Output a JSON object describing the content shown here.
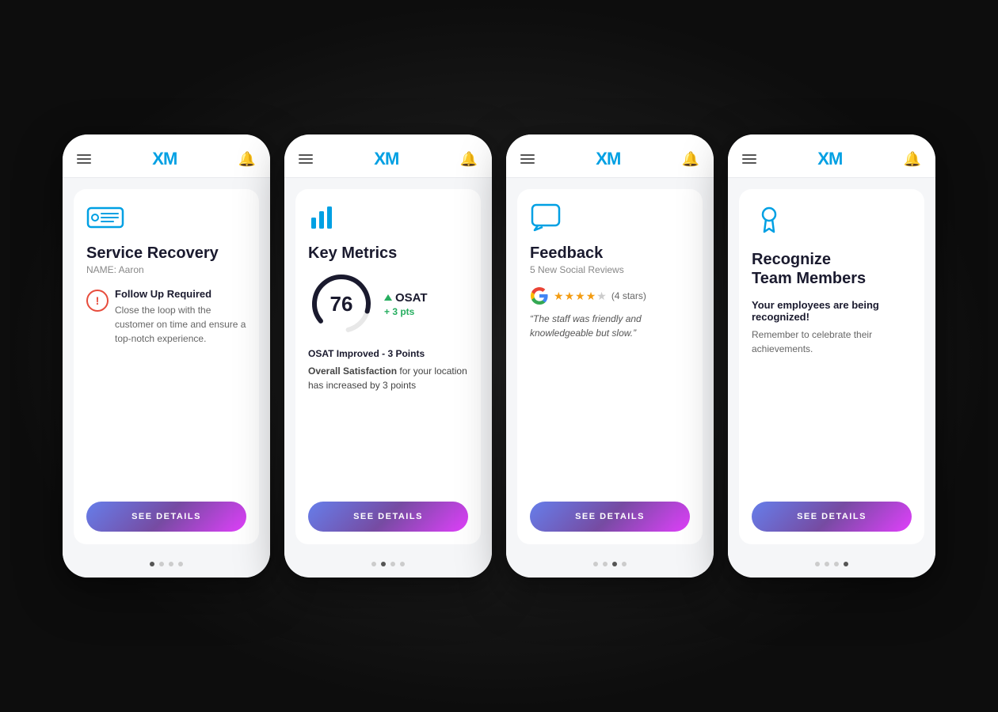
{
  "cards": [
    {
      "id": "service-recovery",
      "logo": "XM",
      "icon_type": "ticket",
      "title": "Service Recovery",
      "subtitle": "NAME: Aaron",
      "alert_title": "Follow Up Required",
      "alert_body": "Close the loop with the customer on time and ensure a top-notch experience.",
      "button_label": "SEE DETAILS",
      "dots": [
        true,
        false,
        false,
        false
      ]
    },
    {
      "id": "key-metrics",
      "logo": "XM",
      "icon_type": "metrics",
      "title": "Key Metrics",
      "subtitle": "",
      "osat_value": "76",
      "osat_label": "OSAT",
      "osat_change": "+ 3 pts",
      "metrics_title": "OSAT Improved - 3 Points",
      "metrics_detail_bold": "Overall Satisfaction",
      "metrics_detail": "for your location has increased by 3 points",
      "button_label": "SEE DETAILS",
      "dots": [
        false,
        true,
        false,
        false
      ]
    },
    {
      "id": "feedback",
      "logo": "XM",
      "icon_type": "feedback",
      "title": "Feedback",
      "subtitle": "5 New Social Reviews",
      "stars_label": "(4 stars)",
      "stars_count": 4,
      "review_text": "“The staff was friendly and knowledgeable but slow.”",
      "button_label": "SEE DETAILS",
      "dots": [
        false,
        false,
        true,
        false
      ]
    },
    {
      "id": "recognize",
      "logo": "XM",
      "icon_type": "recognize",
      "title": "Recognize\nTeam Members",
      "subtitle": "",
      "recognize_highlight": "Your employees are being recognized!",
      "recognize_body": "Remember to celebrate their achievements.",
      "button_label": "SEE DETAILS",
      "dots": [
        false,
        false,
        false,
        true
      ]
    }
  ]
}
